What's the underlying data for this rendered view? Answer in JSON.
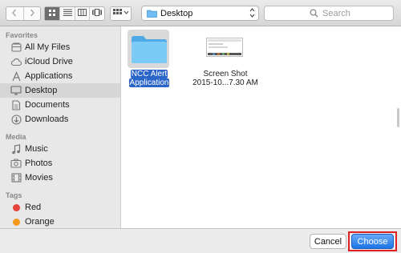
{
  "toolbar": {
    "path_popup": {
      "label": "Desktop",
      "icon": "folder-icon"
    },
    "search": {
      "placeholder": "Search",
      "value": ""
    },
    "view_modes": [
      "icon-view",
      "list-view",
      "column-view",
      "cover-flow-view"
    ],
    "active_view": "icon-view"
  },
  "sidebar": {
    "sections": [
      {
        "heading": "Favorites",
        "items": [
          {
            "label": "All My Files",
            "icon": "all-files-icon"
          },
          {
            "label": "iCloud Drive",
            "icon": "cloud-icon"
          },
          {
            "label": "Applications",
            "icon": "applications-icon"
          },
          {
            "label": "Desktop",
            "icon": "desktop-icon",
            "selected": true
          },
          {
            "label": "Documents",
            "icon": "documents-icon"
          },
          {
            "label": "Downloads",
            "icon": "downloads-icon"
          }
        ]
      },
      {
        "heading": "Media",
        "items": [
          {
            "label": "Music",
            "icon": "music-icon"
          },
          {
            "label": "Photos",
            "icon": "photos-icon"
          },
          {
            "label": "Movies",
            "icon": "movies-icon"
          }
        ]
      },
      {
        "heading": "Tags",
        "items": [
          {
            "label": "Red",
            "color": "#e8413c"
          },
          {
            "label": "Orange",
            "color": "#f39a1c"
          }
        ]
      }
    ]
  },
  "files": [
    {
      "line1": "NCC Alert",
      "line2": "Application",
      "kind": "folder",
      "selected": true
    },
    {
      "line1": "Screen Shot",
      "line2": "2015-10...7.30 AM",
      "kind": "image",
      "selected": false
    }
  ],
  "buttons": {
    "cancel": "Cancel",
    "choose": "Choose"
  },
  "colors": {
    "accent": "#1c74e6",
    "selection": "#2a65c8",
    "highlight_frame": "#e02020",
    "folder": "#5fb8f0"
  }
}
